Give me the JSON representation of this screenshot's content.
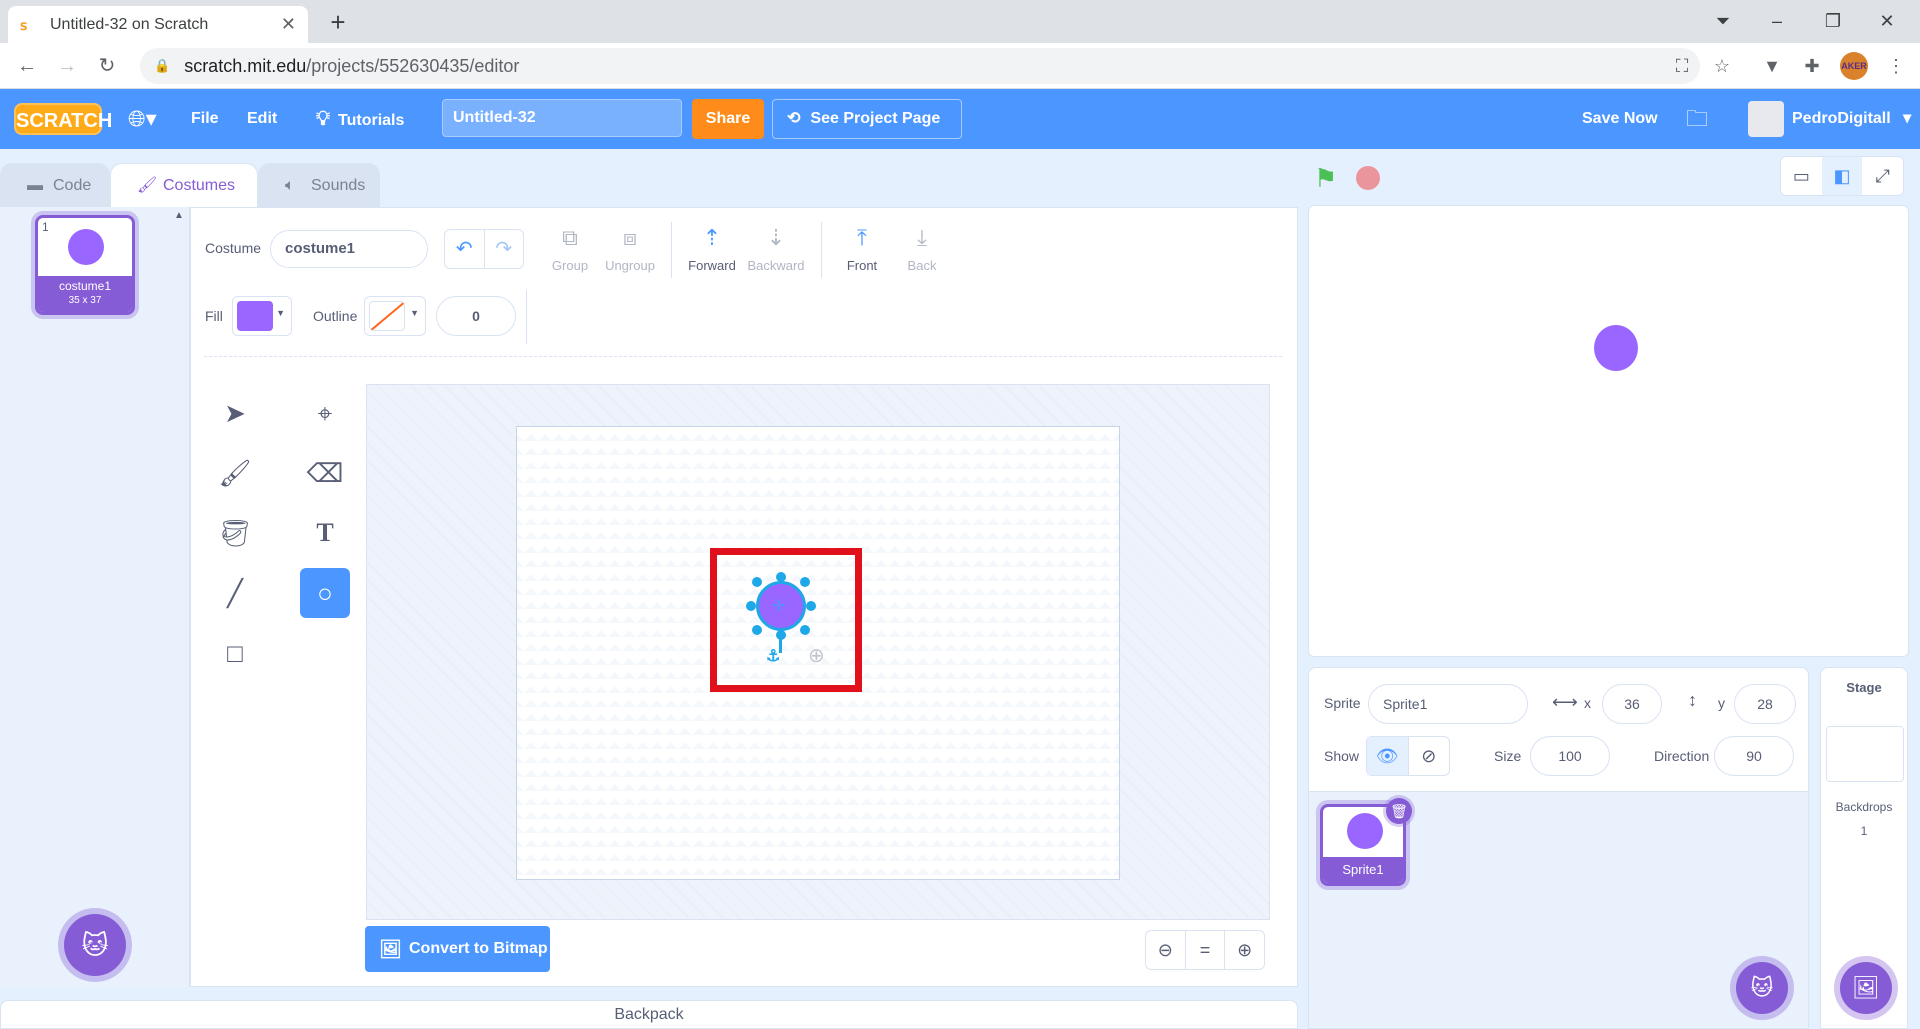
{
  "browser": {
    "tab_title": "Untitled-32 on Scratch",
    "url_host": "scratch.mit.edu",
    "url_path": "/projects/552630435/editor",
    "ext_badge": "AKER"
  },
  "menubar": {
    "logo": "SCRATCH",
    "file": "File",
    "edit": "Edit",
    "tutorials": "Tutorials",
    "project_title": "Untitled-32",
    "share": "Share",
    "see_project_page": "See Project Page",
    "save_now": "Save Now",
    "username": "PedroDigitall"
  },
  "tabs": {
    "code": "Code",
    "costumes": "Costumes",
    "sounds": "Sounds"
  },
  "costume_list": {
    "items": [
      {
        "number": "1",
        "name": "costume1",
        "size": "35 x 37"
      }
    ]
  },
  "paint_editor": {
    "costume_label": "Costume",
    "costume_name": "costume1",
    "group": "Group",
    "ungroup": "Ungroup",
    "forward": "Forward",
    "backward": "Backward",
    "front": "Front",
    "back": "Back",
    "fill_label": "Fill",
    "outline_label": "Outline",
    "outline_width": "0",
    "fill_color": "#9966ff",
    "convert_button": "Convert to Bitmap"
  },
  "sprite_info": {
    "sprite_label": "Sprite",
    "sprite_name": "Sprite1",
    "x_label": "x",
    "x_value": "36",
    "y_label": "y",
    "y_value": "28",
    "show_label": "Show",
    "size_label": "Size",
    "size_value": "100",
    "direction_label": "Direction",
    "direction_value": "90"
  },
  "sprites": [
    {
      "name": "Sprite1"
    }
  ],
  "stage_panel": {
    "title": "Stage",
    "backdrops_label": "Backdrops",
    "backdrops_count": "1"
  },
  "backpack": "Backpack",
  "colors": {
    "scratch_blue": "#4c97ff",
    "scratch_purple": "#855cd6",
    "share_orange": "#ff8c1a",
    "highlight_red": "#e0111a"
  }
}
